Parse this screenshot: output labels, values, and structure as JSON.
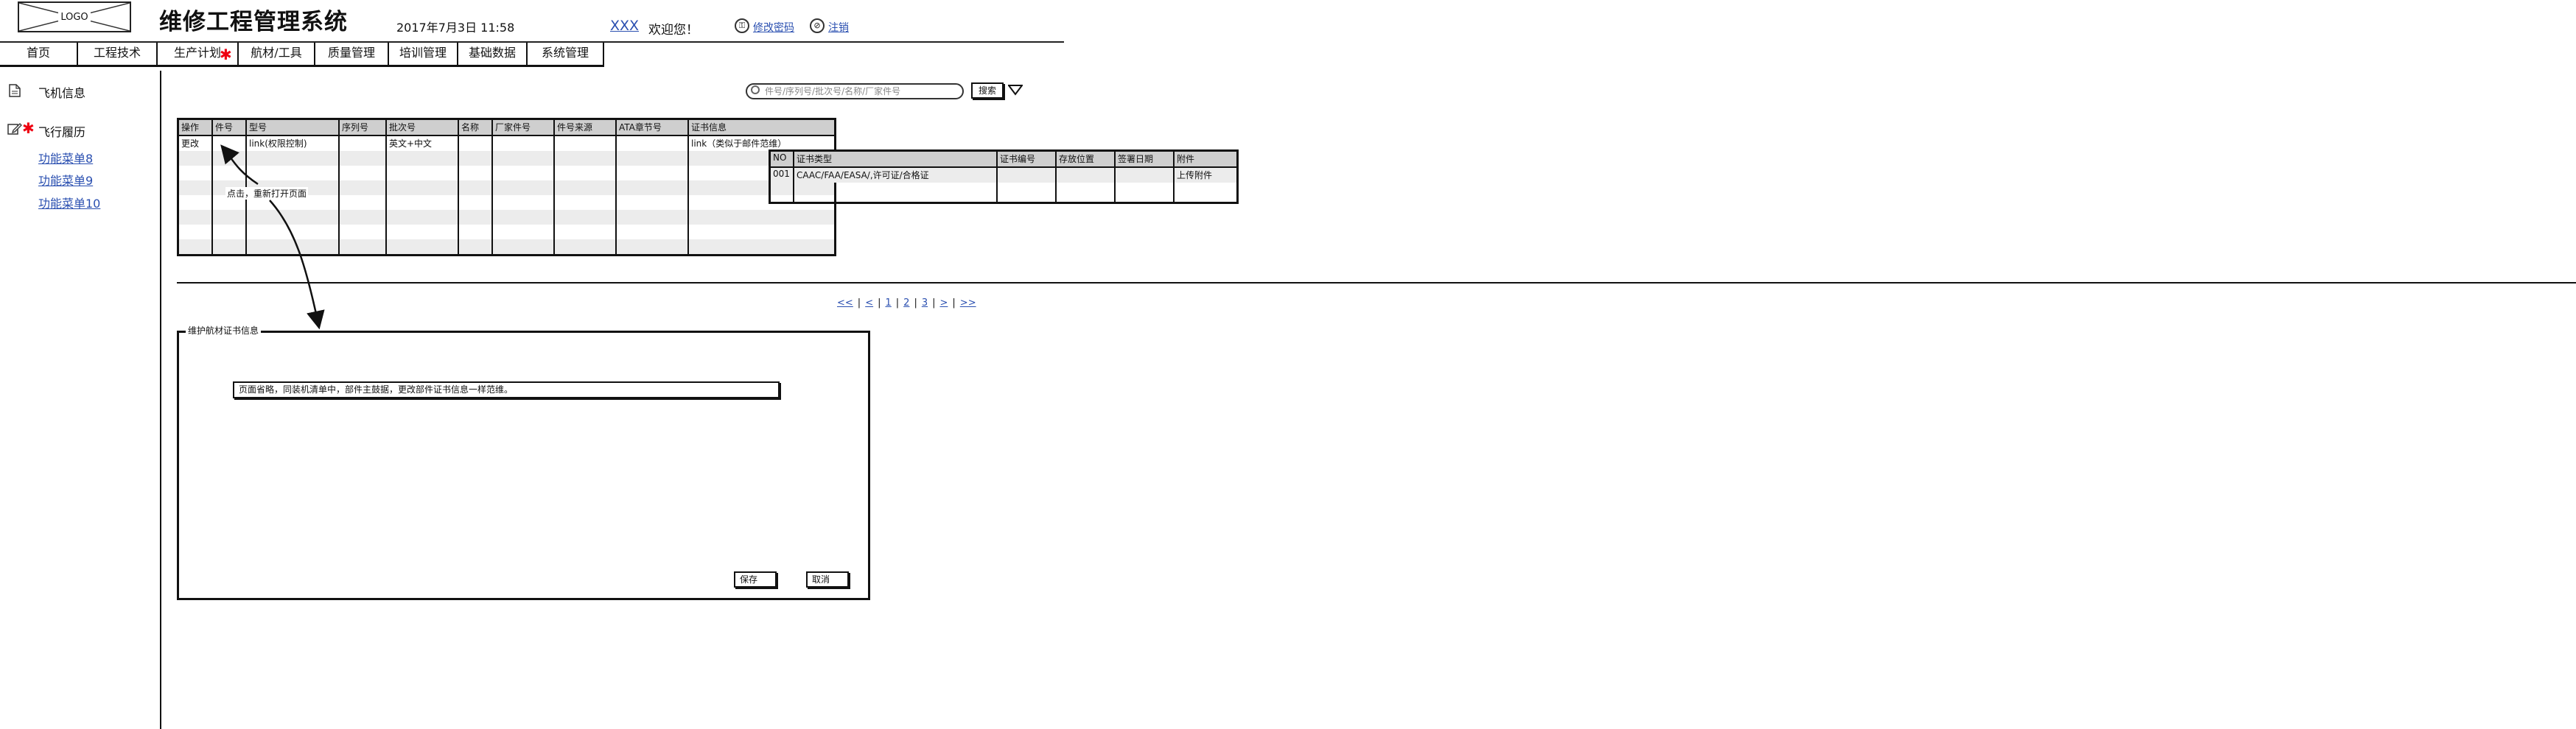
{
  "header": {
    "logo_text": "LOGO",
    "title": "维修工程管理系统",
    "datetime": "2017年7月3日 11:58",
    "user": "XXX",
    "welcome": "欢迎您！",
    "link_password": "修改密码",
    "link_logout": "注销"
  },
  "nav": {
    "items": [
      "首页",
      "工程技术",
      "生产计划",
      "航材/工具",
      "质量管理",
      "培训管理",
      "基础数据",
      "系统管理"
    ],
    "marked": "生产计划"
  },
  "sidebar": {
    "section1": "飞机信息",
    "section2": "飞行履历",
    "links": [
      "功能菜单8",
      "功能菜单9",
      "功能菜单10"
    ]
  },
  "search": {
    "placeholder": "件号/序列号/批次号/名称/厂家件号",
    "button": "搜索"
  },
  "main_table": {
    "headers": [
      "操作",
      "件号",
      "型号",
      "序列号",
      "批次号",
      "名称",
      "厂家件号",
      "件号来源",
      "ATA章节号",
      "证书信息"
    ],
    "row1": {
      "op": "更改",
      "model": "link(权限控制)",
      "batch": "英文+中文",
      "cert": "link（类似于邮件范维）"
    }
  },
  "sub_table": {
    "headers": [
      "NO",
      "证书类型",
      "证书编号",
      "存放位置",
      "签署日期",
      "附件"
    ],
    "row1": {
      "no": "001",
      "type": "CAAC/FAA/EASA/,许可证/合格证",
      "attachment": "上传附件"
    }
  },
  "annotation": "点击，重新打开页面",
  "pager": [
    "<<",
    "<",
    "1",
    "2",
    "3",
    ">",
    ">>"
  ],
  "panel": {
    "legend": "维护航材证书信息",
    "note": "页面省略，同装机清单中，部件主鼓据，更改部件证书信息一样范维。",
    "save": "保存",
    "cancel": "取消"
  }
}
